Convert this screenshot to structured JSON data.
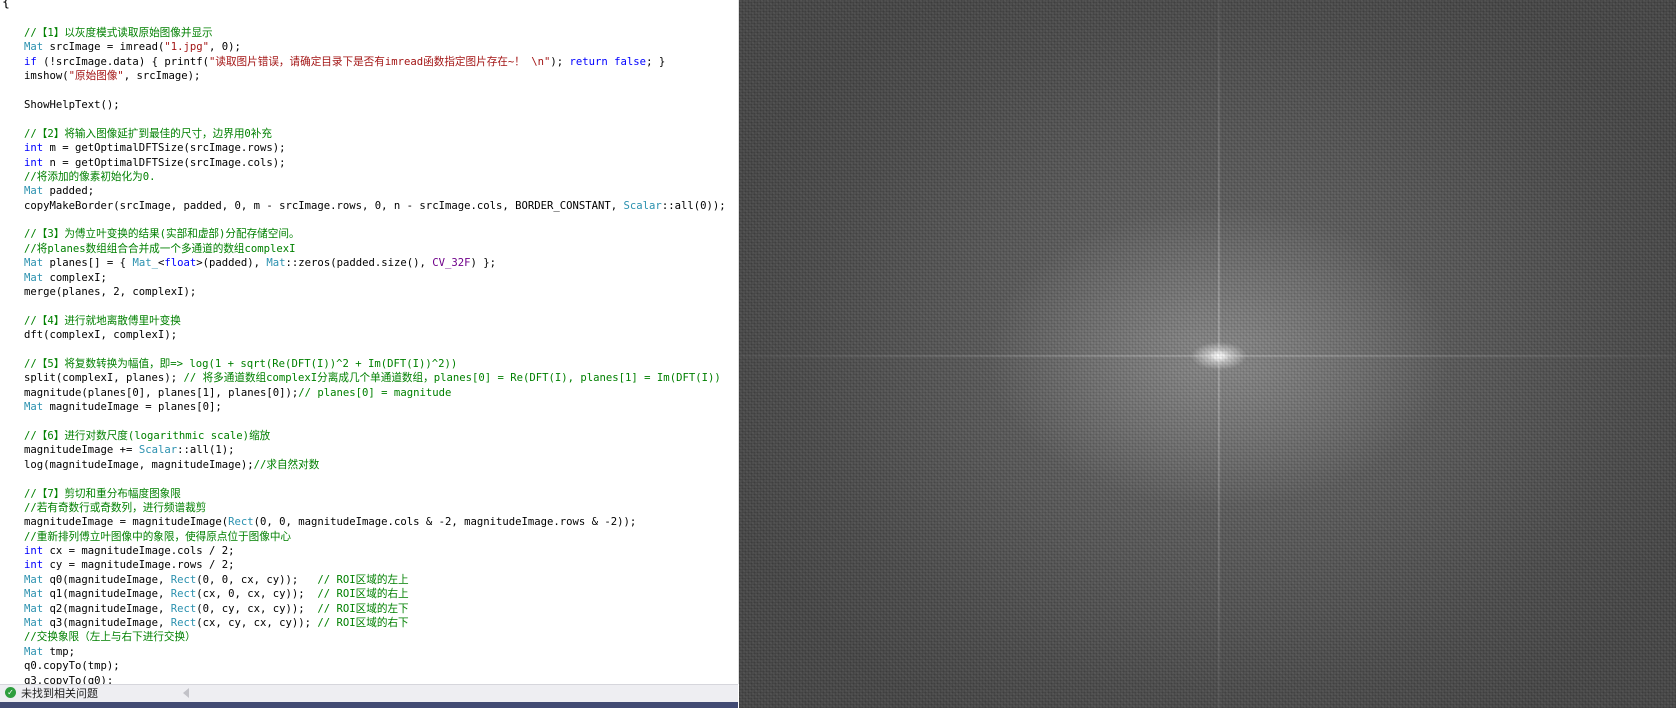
{
  "editor": {
    "brace": "{",
    "lines": [
      [
        [
          "c",
          "//【1】以灰度模式读取原始图像并显示"
        ]
      ],
      [
        [
          "y",
          "Mat"
        ],
        [
          "n",
          " srcImage = imread("
        ],
        [
          "s",
          "\"1.jpg\""
        ],
        [
          "n",
          ", 0);"
        ]
      ],
      [
        [
          "k",
          "if"
        ],
        [
          "n",
          " (!srcImage.data) { printf("
        ],
        [
          "s",
          "\"读取图片错误，请确定目录下是否有imread函数指定图片存在~！ \\n\""
        ],
        [
          "n",
          "); "
        ],
        [
          "k",
          "return false"
        ],
        [
          "n",
          "; }"
        ]
      ],
      [
        [
          "n",
          "imshow("
        ],
        [
          "s",
          "\"原始图像\""
        ],
        [
          "n",
          ", srcImage);"
        ]
      ],
      [
        [
          "n",
          ""
        ]
      ],
      [
        [
          "n",
          "ShowHelpText();"
        ]
      ],
      [
        [
          "n",
          ""
        ]
      ],
      [
        [
          "c",
          "//【2】将输入图像延扩到最佳的尺寸，边界用0补充"
        ]
      ],
      [
        [
          "k",
          "int"
        ],
        [
          "n",
          " m = getOptimalDFTSize(srcImage.rows);"
        ]
      ],
      [
        [
          "k",
          "int"
        ],
        [
          "n",
          " n = getOptimalDFTSize(srcImage.cols);"
        ]
      ],
      [
        [
          "c",
          "//将添加的像素初始化为0."
        ]
      ],
      [
        [
          "y",
          "Mat"
        ],
        [
          "n",
          " padded;"
        ]
      ],
      [
        [
          "n",
          "copyMakeBorder(srcImage, padded, 0, m - srcImage.rows, 0, n - srcImage.cols, BORDER_CONSTANT, "
        ],
        [
          "y",
          "Scalar"
        ],
        [
          "n",
          "::all(0));"
        ]
      ],
      [
        [
          "n",
          ""
        ]
      ],
      [
        [
          "c",
          "//【3】为傅立叶变换的结果(实部和虚部)分配存储空间。"
        ]
      ],
      [
        [
          "c",
          "//将planes数组组合合并成一个多通道的数组complexI"
        ]
      ],
      [
        [
          "y",
          "Mat"
        ],
        [
          "n",
          " planes[] = { "
        ],
        [
          "y",
          "Mat_"
        ],
        [
          "n",
          "<"
        ],
        [
          "k",
          "float"
        ],
        [
          "n",
          ">(padded), "
        ],
        [
          "y",
          "Mat"
        ],
        [
          "n",
          "::zeros(padded.size(), "
        ],
        [
          "m",
          "CV_32F"
        ],
        [
          "n",
          ") };"
        ]
      ],
      [
        [
          "y",
          "Mat"
        ],
        [
          "n",
          " complexI;"
        ]
      ],
      [
        [
          "n",
          "merge(planes, 2, complexI);"
        ]
      ],
      [
        [
          "n",
          ""
        ]
      ],
      [
        [
          "c",
          "//【4】进行就地离散傅里叶变换"
        ]
      ],
      [
        [
          "n",
          "dft(complexI, complexI);"
        ]
      ],
      [
        [
          "n",
          ""
        ]
      ],
      [
        [
          "c",
          "//【5】将复数转换为幅值，即=> log(1 + sqrt(Re(DFT(I))^2 + Im(DFT(I))^2))"
        ]
      ],
      [
        [
          "n",
          "split(complexI, planes); "
        ],
        [
          "c",
          "// 将多通道数组complexI分离成几个单通道数组，planes[0] = Re(DFT(I), planes[1] = Im(DFT(I))"
        ]
      ],
      [
        [
          "n",
          "magnitude(planes[0], planes[1], planes[0]);"
        ],
        [
          "c",
          "// planes[0] = magnitude"
        ]
      ],
      [
        [
          "y",
          "Mat"
        ],
        [
          "n",
          " magnitudeImage = planes[0];"
        ]
      ],
      [
        [
          "n",
          ""
        ]
      ],
      [
        [
          "c",
          "//【6】进行对数尺度(logarithmic scale)缩放"
        ]
      ],
      [
        [
          "n",
          "magnitudeImage += "
        ],
        [
          "y",
          "Scalar"
        ],
        [
          "n",
          "::all(1);"
        ]
      ],
      [
        [
          "n",
          "log(magnitudeImage, magnitudeImage);"
        ],
        [
          "c",
          "//求自然对数"
        ]
      ],
      [
        [
          "n",
          ""
        ]
      ],
      [
        [
          "c",
          "//【7】剪切和重分布幅度图象限"
        ]
      ],
      [
        [
          "c",
          "//若有奇数行或奇数列，进行频谱裁剪"
        ]
      ],
      [
        [
          "n",
          "magnitudeImage = magnitudeImage("
        ],
        [
          "y",
          "Rect"
        ],
        [
          "n",
          "(0, 0, magnitudeImage.cols & -2, magnitudeImage.rows & -2));"
        ]
      ],
      [
        [
          "c",
          "//重新排列傅立叶图像中的象限，使得原点位于图像中心"
        ]
      ],
      [
        [
          "k",
          "int"
        ],
        [
          "n",
          " cx = magnitudeImage.cols / 2;"
        ]
      ],
      [
        [
          "k",
          "int"
        ],
        [
          "n",
          " cy = magnitudeImage.rows / 2;"
        ]
      ],
      [
        [
          "y",
          "Mat"
        ],
        [
          "n",
          " q0(magnitudeImage, "
        ],
        [
          "y",
          "Rect"
        ],
        [
          "n",
          "(0, 0, cx, cy));   "
        ],
        [
          "c",
          "// ROI区域的左上"
        ]
      ],
      [
        [
          "y",
          "Mat"
        ],
        [
          "n",
          " q1(magnitudeImage, "
        ],
        [
          "y",
          "Rect"
        ],
        [
          "n",
          "(cx, 0, cx, cy));  "
        ],
        [
          "c",
          "// ROI区域的右上"
        ]
      ],
      [
        [
          "y",
          "Mat"
        ],
        [
          "n",
          " q2(magnitudeImage, "
        ],
        [
          "y",
          "Rect"
        ],
        [
          "n",
          "(0, cy, cx, cy));  "
        ],
        [
          "c",
          "// ROI区域的左下"
        ]
      ],
      [
        [
          "y",
          "Mat"
        ],
        [
          "n",
          " q3(magnitudeImage, "
        ],
        [
          "y",
          "Rect"
        ],
        [
          "n",
          "(cx, cy, cx, cy)); "
        ],
        [
          "c",
          "// ROI区域的右下"
        ]
      ],
      [
        [
          "c",
          "//交换象限（左上与右下进行交换）"
        ]
      ],
      [
        [
          "y",
          "Mat"
        ],
        [
          "n",
          " tmp;"
        ]
      ],
      [
        [
          "n",
          "q0.copyTo(tmp);"
        ]
      ],
      [
        [
          "n",
          "q3.copyTo(q0);"
        ]
      ]
    ]
  },
  "status": {
    "text": "未找到相关问题",
    "icon": "check-circle-icon"
  },
  "colors": {
    "keyword": "#0000ff",
    "comment": "#008000",
    "string": "#a31515",
    "type": "#2b91af",
    "macro": "#6f008a",
    "status_ok": "#2e9e3e"
  },
  "spectrum": {
    "icon": "fourier-spectrum-image"
  }
}
